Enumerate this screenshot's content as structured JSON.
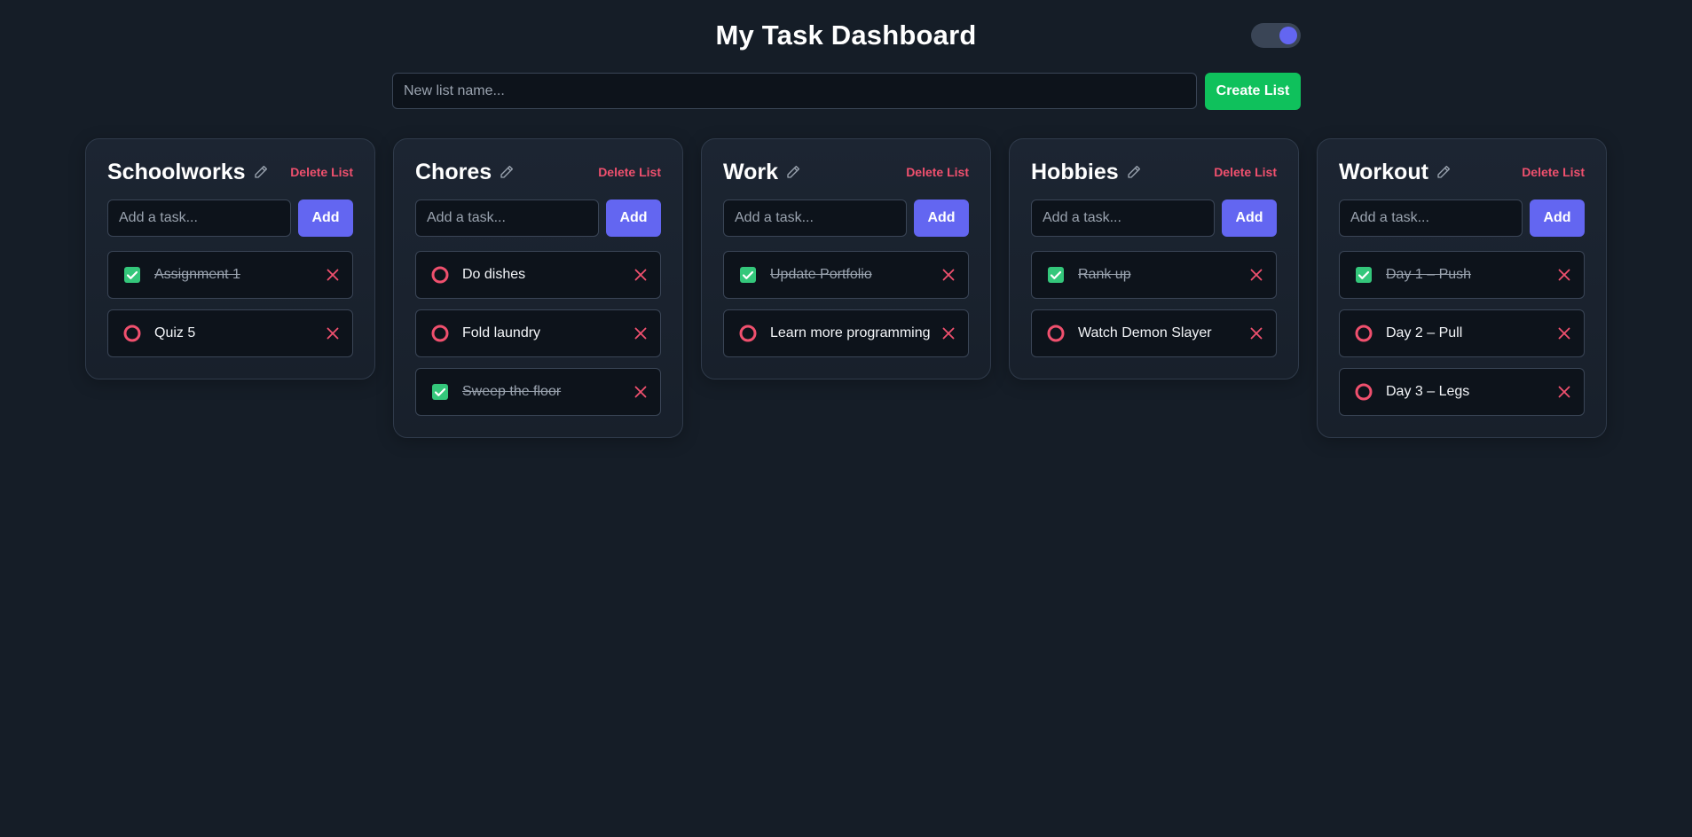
{
  "header": {
    "title": "My Task Dashboard"
  },
  "theme_toggle": {
    "state": "on",
    "accent": "#6366f1"
  },
  "new_list": {
    "placeholder": "New list name...",
    "value": "",
    "create_label": "Create List"
  },
  "colors": {
    "background": "#151d27",
    "primary": "#6366f1",
    "success": "#0fc15c",
    "danger": "#f0506e",
    "check": "#34c77b"
  },
  "icons": {
    "edit": "pencil-icon",
    "done": "checkbox-checked-icon",
    "pending": "circle-icon",
    "remove": "close-icon"
  },
  "lists": [
    {
      "title": "Schoolworks",
      "delete_label": "Delete List",
      "task_placeholder": "Add a task...",
      "add_label": "Add",
      "tasks": [
        {
          "text": "Assignment 1",
          "done": true
        },
        {
          "text": "Quiz 5",
          "done": false
        }
      ]
    },
    {
      "title": "Chores",
      "delete_label": "Delete List",
      "task_placeholder": "Add a task...",
      "add_label": "Add",
      "tasks": [
        {
          "text": "Do dishes",
          "done": false
        },
        {
          "text": "Fold laundry",
          "done": false
        },
        {
          "text": "Sweep the floor",
          "done": true
        }
      ]
    },
    {
      "title": "Work",
      "delete_label": "Delete List",
      "task_placeholder": "Add a task...",
      "add_label": "Add",
      "tasks": [
        {
          "text": "Update Portfolio",
          "done": true
        },
        {
          "text": "Learn more programming",
          "done": false
        }
      ]
    },
    {
      "title": "Hobbies",
      "delete_label": "Delete List",
      "task_placeholder": "Add a task...",
      "add_label": "Add",
      "tasks": [
        {
          "text": "Rank up",
          "done": true
        },
        {
          "text": "Watch Demon Slayer",
          "done": false
        }
      ]
    },
    {
      "title": "Workout",
      "delete_label": "Delete List",
      "task_placeholder": "Add a task...",
      "add_label": "Add",
      "tasks": [
        {
          "text": "Day 1 – Push",
          "done": true
        },
        {
          "text": "Day 2 – Pull",
          "done": false
        },
        {
          "text": "Day 3 – Legs",
          "done": false
        }
      ]
    }
  ]
}
